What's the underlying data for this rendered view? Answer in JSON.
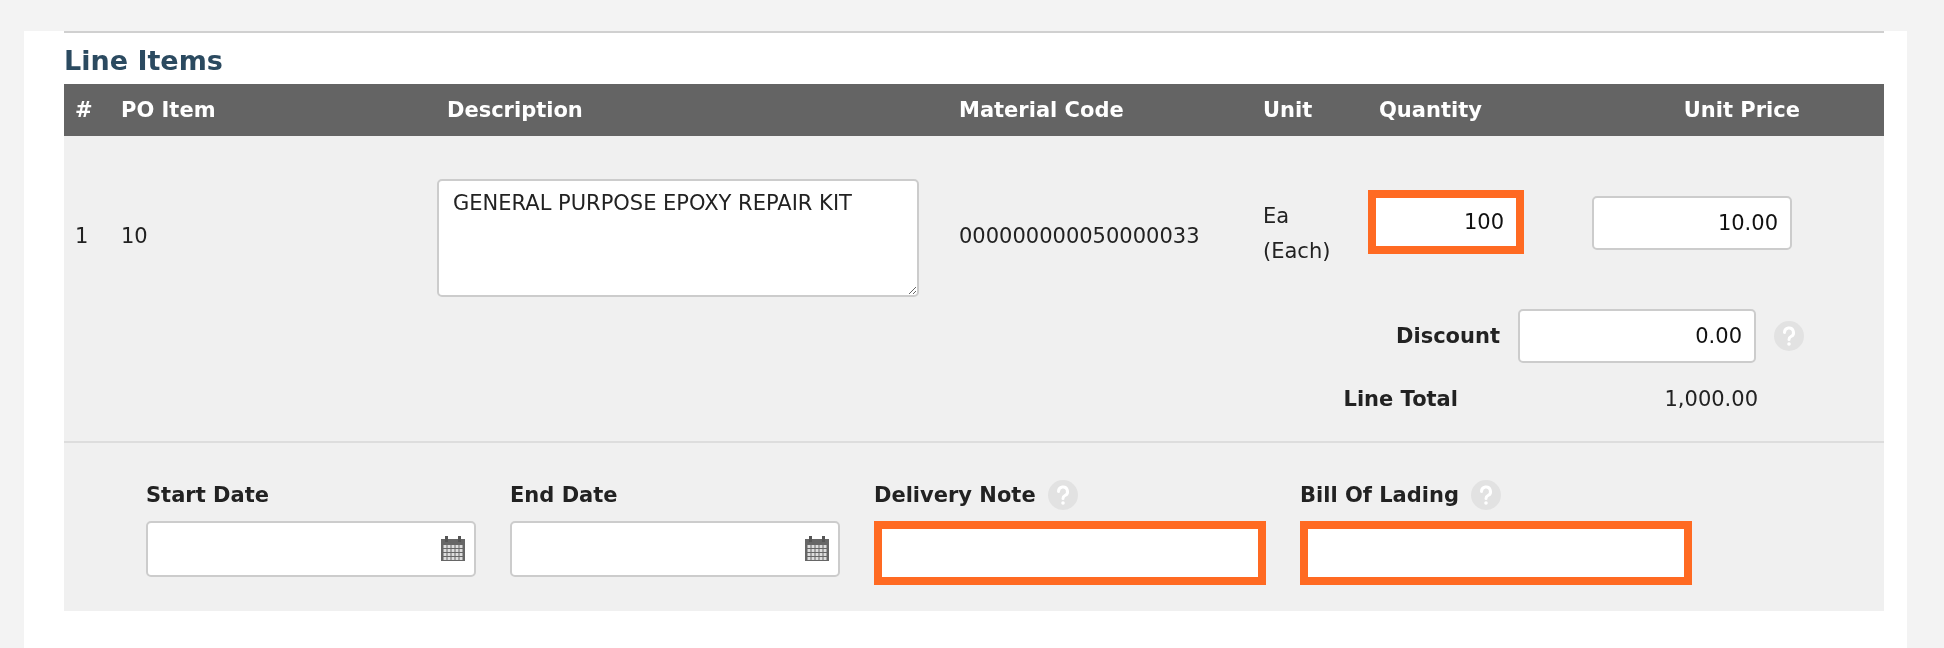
{
  "section_title": "Line Items",
  "table": {
    "columns": [
      "#",
      "PO Item",
      "Description",
      "Material Code",
      "Unit",
      "Quantity",
      "Unit Price"
    ],
    "rows": [
      {
        "number": "1",
        "po_item": "10",
        "description": "GENERAL PURPOSE EPOXY REPAIR KIT",
        "material_code": "000000000050000033",
        "unit": "Ea (Each)",
        "quantity": {
          "value": "100",
          "highlighted": true
        },
        "unit_price": {
          "value": "10.00",
          "highlighted": false
        },
        "discount": {
          "label": "Discount",
          "value": "0.00",
          "help": true
        },
        "line_total": {
          "label": "Line Total",
          "value": "1,000.00"
        },
        "details": [
          {
            "kind": "date",
            "label": "Start Date",
            "help": false,
            "highlighted": false
          },
          {
            "kind": "date",
            "label": "End Date",
            "help": false,
            "highlighted": false
          },
          {
            "kind": "text",
            "label": "Delivery Note",
            "help": true,
            "highlighted": true
          },
          {
            "kind": "text",
            "label": "Bill Of Lading",
            "help": true,
            "highlighted": true
          }
        ]
      }
    ]
  }
}
